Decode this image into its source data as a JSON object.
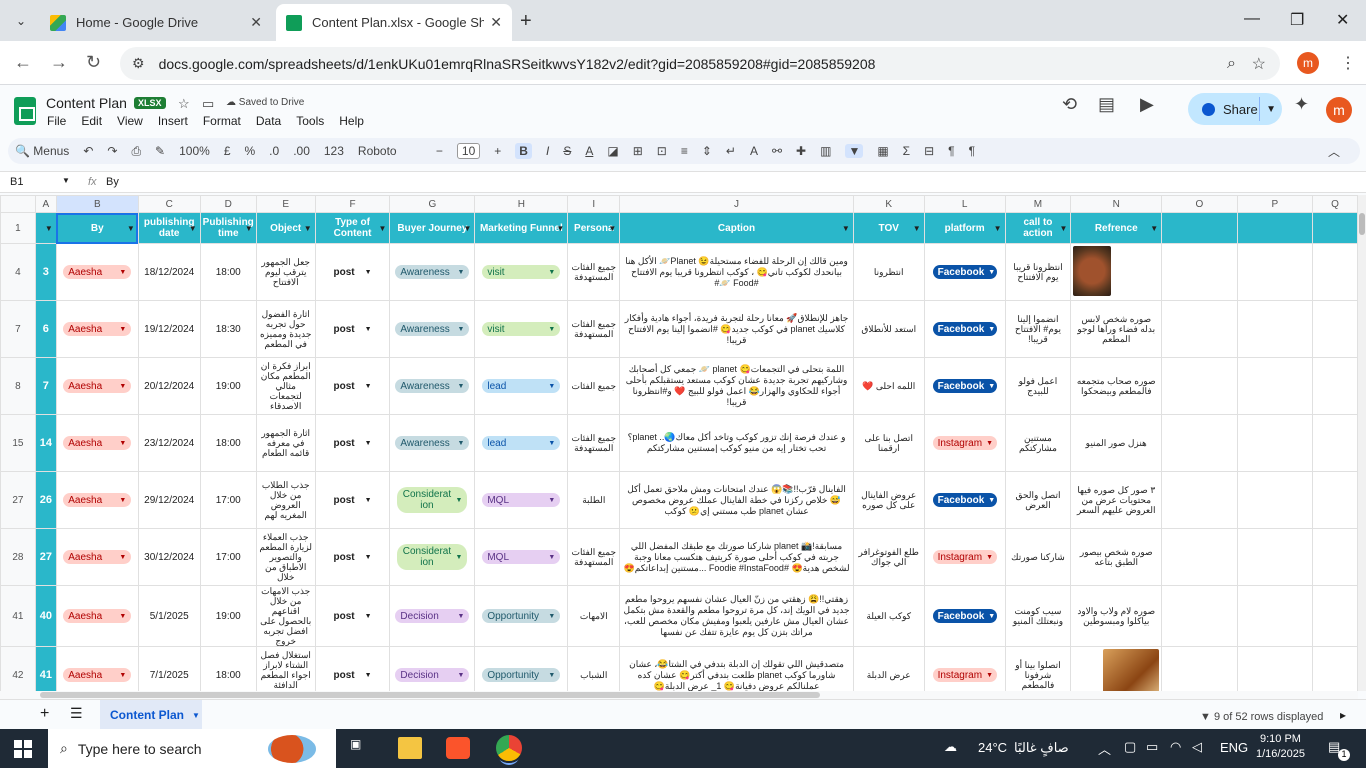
{
  "browser": {
    "tab1": "Home - Google Drive",
    "tab2": "Content Plan.xlsx - Google Sheets",
    "url": "docs.google.com/spreadsheets/d/1enkUKu01emrqRlnaSRSeitkwvsY182v2/edit?gid=2085859208#gid=2085859208",
    "profile": "m"
  },
  "doc": {
    "title": "Content Plan",
    "badge": "XLSX",
    "saved": "Saved to Drive",
    "menus": [
      "File",
      "Edit",
      "View",
      "Insert",
      "Format",
      "Data",
      "Tools",
      "Help"
    ],
    "share": "Share",
    "avatar": "m"
  },
  "toolbar": {
    "menus": "Menus",
    "zoom": "100%",
    "currency": "£",
    "percent": "%",
    "dec1": ".0",
    "dec2": ".00",
    "num": "123",
    "font": "Roboto",
    "size": "10"
  },
  "formula": {
    "cell": "B1",
    "value": "By"
  },
  "columns": [
    "A",
    "B",
    "C",
    "D",
    "E",
    "F",
    "G",
    "H",
    "I",
    "J",
    "K",
    "L",
    "M",
    "N",
    "O",
    "P",
    "Q"
  ],
  "headers": [
    "By",
    "publishing date",
    "Publishing time",
    "Object",
    "Type of Content",
    "Buyer Journey",
    "Marketing Funnel",
    "Persona",
    "Caption",
    "TOV",
    "platform",
    "call to action",
    "Refrence"
  ],
  "rows": [
    {
      "rn": "4",
      "id": "3",
      "by": "Aaesha",
      "date": "18/12/2024",
      "time": "18:00",
      "object": "جعل الجمهور يترقب ليوم الافتتاح",
      "type": "post",
      "journey": "Awareness",
      "funnel": "visit",
      "persona": "جميع الفئات المستهدفة",
      "caption": "ومين قالك إن الرحلة للفضاء مستحيلة😉 Planet🪐 الأكل هنا بيانحدك لكوكب تاني😋 ، كوكب انتظرونا قريبا يوم الافتتاح #Food 🪐#",
      "tov": "انتظرونا",
      "platform": "Facebook",
      "cta": "انتظرونا قريبا يوم الافتتاح",
      "ref": ""
    },
    {
      "rn": "7",
      "id": "6",
      "by": "Aaesha",
      "date": "19/12/2024",
      "time": "18:30",
      "object": "اثارة الفضول حول تجربه جديدة ومميزه في المطعم",
      "type": "post",
      "journey": "Awareness",
      "funnel": "visit",
      "persona": "جميع الفئات المستهدفة",
      "caption": "جاهز للإنطلاق🚀 معانا رحلة لتجربة فريدة، أجواء هادية وأفكار كلاسيك planet في كوكب جديد😋 #انضموا إلينا يوم الافتتاح قريبا!",
      "tov": "استعد للأنطلاق",
      "platform": "Facebook",
      "cta": "انضموا إلينا يوم# الافتتاح قريبا!",
      "ref": "صوره شخص لابس بدله فضاء وراها لوجو المطعم"
    },
    {
      "rn": "8",
      "id": "7",
      "by": "Aaesha",
      "date": "20/12/2024",
      "time": "19:00",
      "object": "ابراز فكرة ان المطعم مكان مثالي لتجمعات الاصدقاء",
      "type": "post",
      "journey": "Awareness",
      "funnel": "lead",
      "persona": "جميع الفئات",
      "caption": "اللمة بتحلى في التجمعات😋 planet 🪐 جمعي كل أصحابك وشاركيهم تجربة جديدة عشان كوكب مستعد يستقبلكم بأحلى أجواء للحكاوي والهزار😂 اعمل فولو للبيج ❤️ و#انتظرونا قريبا!",
      "tov": "اللمه احلى ❤️",
      "platform": "Facebook",
      "cta": "اعمل فولو للبيدج",
      "ref": "صوره صحاب متجمعه فالمطعم وبيضحكوا"
    },
    {
      "rn": "15",
      "id": "14",
      "by": "Aaesha",
      "date": "23/12/2024",
      "time": "18:00",
      "object": "اثارة الجمهور في معرفه قائمه الطعام",
      "type": "post",
      "journey": "Awareness",
      "funnel": "lead",
      "persona": "جميع الفئات المستهدفة",
      "caption": "و عندك فرصة إنك تزور كوكب وتاخد أكل معاك🌏.. planet؟ تحب تختار إيه من منيو كوكب |مستنين مشاركتكم",
      "tov": "اتصل بنا على ارقمنا",
      "platform": "Instagram",
      "cta": "مستنين مشاركتكم",
      "ref": "هنزل صور المنيو"
    },
    {
      "rn": "27",
      "id": "26",
      "by": "Aaesha",
      "date": "29/12/2024",
      "time": "17:00",
      "object": "جذب الطلاب من خلال العروض المغريه لهم",
      "type": "post",
      "journey": "Considerat ion",
      "funnel": "MQL",
      "persona": "الطلبة",
      "caption": "الفاينال قرّب!!📚😱 عندك امتحانات ومش ملاحق تعمل أكل😅 خلاص ركزنا في خطة الفاينال عملك عروض مخصوص عشان planet طب مستني إي😕 كوكب",
      "tov": "عروض الفاينال على كل صوره",
      "platform": "Facebook",
      "cta": "اتصل والحق العرض",
      "ref": "٣ صور كل صوره فيها محتويات عرض من العروض عليهم السعر"
    },
    {
      "rn": "28",
      "id": "27",
      "by": "Aaesha",
      "date": "30/12/2024",
      "time": "17:00",
      "object": "جذب العملاء لزيارة المطعم والتصوير الاطباق من خلال",
      "type": "post",
      "journey": "Considerat ion",
      "funnel": "MQL",
      "persona": "جميع الفئات المستهدفة",
      "caption": "مسابقة!📸 planet شاركنا صورتك مع طبقك المفضل اللي جربته في كوكب أحلى صورة كريتيف هتكسب معانا وجبة لشخص هدية😍 #Foodie #InstaFood ...مستنين إبداعاتكم😍",
      "tov": "طلع الفوتوغرافر الي جواك",
      "platform": "Instagram",
      "cta": "شاركنا صورتك",
      "ref": "صوره شخص بيصور الطبق بتاعه"
    },
    {
      "rn": "41",
      "id": "40",
      "by": "Aaesha",
      "date": "5/1/2025",
      "time": "19:00",
      "object": "جذب الامهات من خلال اقناعهم بالحصول على افضل تجربه خروج",
      "type": "post",
      "journey": "Decision",
      "funnel": "Opportunity",
      "persona": "الامهات",
      "caption": "زهقتي!!😩 زهقتي من زنّ العيال عشان نفسهم يروحوا مطعم جديد في الويك إند، كل مرة تروحوا مطعم والقعدة مش بتكمل عشان العيال مش عارفين يلعبوا ومفيش مكان مخصص للعب، مراتك بتزن كل يوم عايزة تتفك عن نفسها",
      "tov": "كوكب العيلة",
      "platform": "Facebook",
      "cta": "سيب كومنت ونبعتلك المنيو",
      "ref": "صوره لام ولاب والاود بياكلوا ومبسوطين"
    },
    {
      "rn": "42",
      "id": "41",
      "by": "Aaesha",
      "date": "7/1/2025",
      "time": "18:00",
      "object": "استغلال فصل الشتاء لابراز اجواء المطعم الدافئة والمرحة",
      "type": "post",
      "journey": "Decision",
      "funnel": "Opportunity",
      "persona": "الشباب",
      "caption": "متصدقيش اللي تقولك إن الدبلة بتدفي في الشتا😂، عشان شاورما كوكب planet طلعت بتدفي أكتر😋 عشان كده عملنالكم عروض دفيانة😋 1_ عرض الدبلة😋",
      "tov": "عرض الدبلة",
      "platform": "Instagram",
      "cta": "اتصلوا بينا أو شرفونا فالمطعم",
      "ref": ""
    }
  ],
  "status": {
    "sheet": "Content Plan",
    "rows": "9 of 52 rows displayed"
  },
  "taskbar": {
    "search": "Type here to search",
    "temp": "24°C",
    "weather": "صافٍ غالبًا",
    "lang": "ENG",
    "time": "9:10 PM",
    "date": "1/16/2025",
    "notif": "1"
  }
}
